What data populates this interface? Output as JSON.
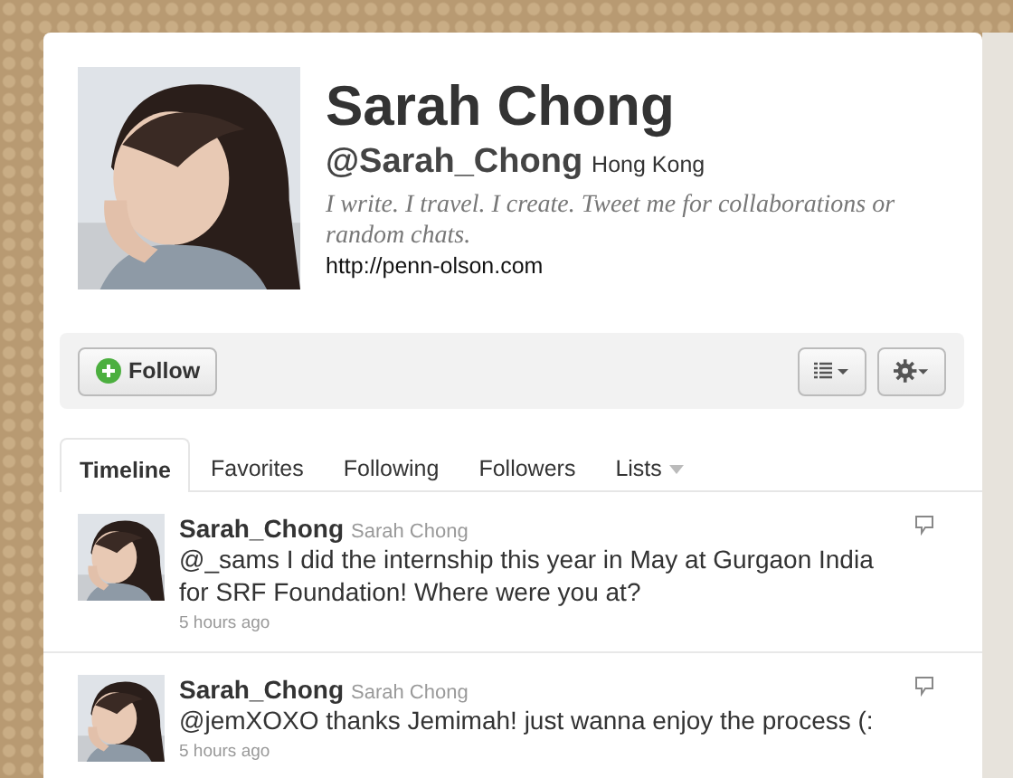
{
  "profile": {
    "name": "Sarah Chong",
    "handle": "@Sarah_Chong",
    "location": "Hong Kong",
    "bio": "I write. I travel. I create. Tweet me for collaborations or random chats.",
    "url": "http://penn-olson.com"
  },
  "actions": {
    "follow_label": "Follow"
  },
  "tabs": [
    {
      "label": "Timeline",
      "selected": true,
      "dropdown": false
    },
    {
      "label": "Favorites",
      "selected": false,
      "dropdown": false
    },
    {
      "label": "Following",
      "selected": false,
      "dropdown": false
    },
    {
      "label": "Followers",
      "selected": false,
      "dropdown": false
    },
    {
      "label": "Lists",
      "selected": false,
      "dropdown": true
    }
  ],
  "tweets": [
    {
      "username": "Sarah_Chong",
      "full_name": "Sarah Chong",
      "text": "@_sams I did the internship this year in May at Gurgaon India for SRF Foundation! Where were you at?",
      "time": "5 hours ago"
    },
    {
      "username": "Sarah_Chong",
      "full_name": "Sarah Chong",
      "text": "@jemXOXO thanks Jemimah! just wanna enjoy the process (:",
      "time": "5 hours ago"
    }
  ]
}
